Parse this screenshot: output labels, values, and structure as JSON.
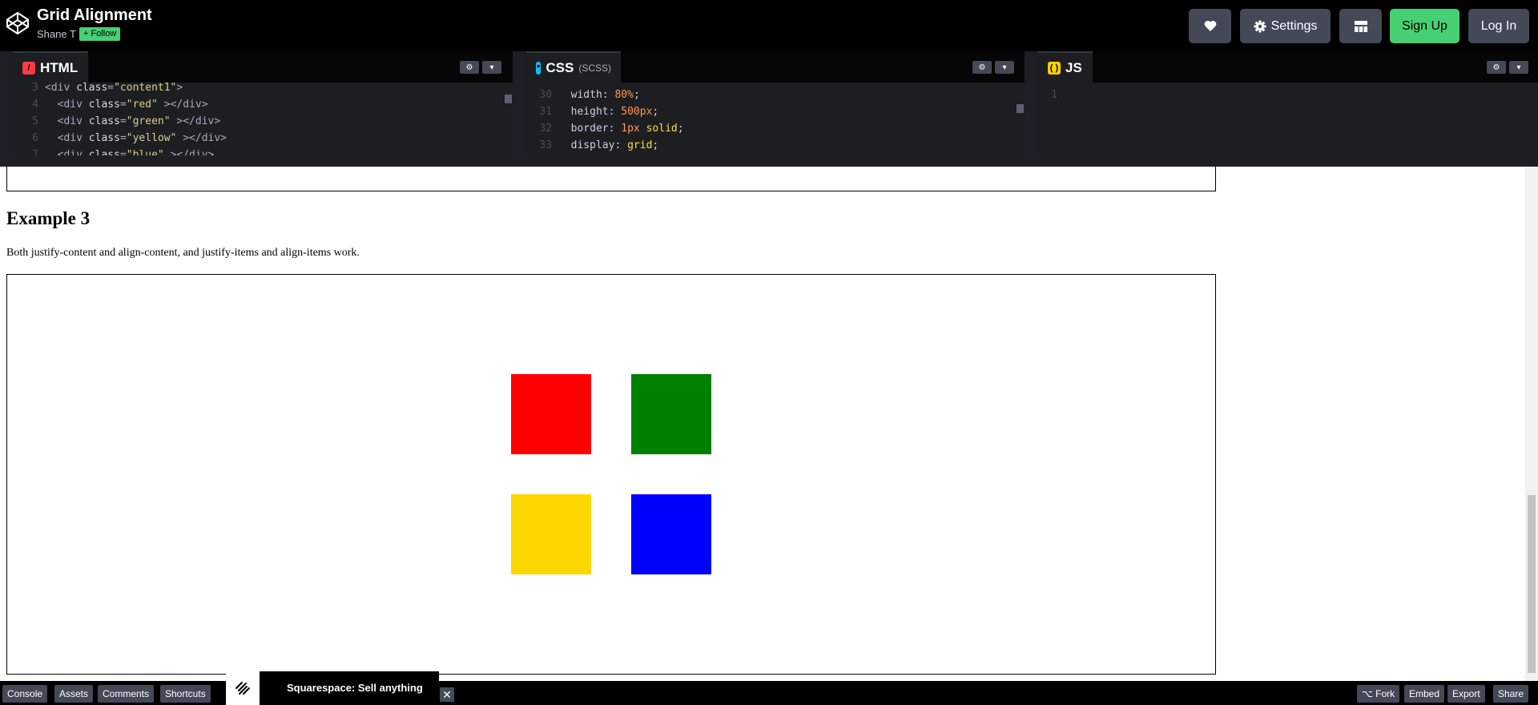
{
  "header": {
    "title": "Grid Alignment",
    "author": "Shane T",
    "follow_label": "+ Follow",
    "settings_label": "Settings",
    "signup_label": "Sign Up",
    "login_label": "Log In"
  },
  "editors": {
    "html": {
      "tab_label": "HTML",
      "lines": [
        {
          "n": "3",
          "parts": [
            [
              "tag",
              "<div "
            ],
            [
              "attr",
              "class"
            ],
            [
              "tag",
              "="
            ],
            [
              "str",
              "\"content1\""
            ],
            [
              "tag",
              ">"
            ]
          ]
        },
        {
          "n": "4",
          "parts": [
            [
              "plain",
              "  "
            ],
            [
              "tag",
              "<div "
            ],
            [
              "attr",
              "class"
            ],
            [
              "tag",
              "="
            ],
            [
              "str",
              "\"red\""
            ],
            [
              "tag",
              " ></div>"
            ]
          ]
        },
        {
          "n": "5",
          "parts": [
            [
              "plain",
              "  "
            ],
            [
              "tag",
              "<div "
            ],
            [
              "attr",
              "class"
            ],
            [
              "tag",
              "="
            ],
            [
              "str",
              "\"green\""
            ],
            [
              "tag",
              " ></div>"
            ]
          ]
        },
        {
          "n": "6",
          "parts": [
            [
              "plain",
              "  "
            ],
            [
              "tag",
              "<div "
            ],
            [
              "attr",
              "class"
            ],
            [
              "tag",
              "="
            ],
            [
              "str",
              "\"yellow\""
            ],
            [
              "tag",
              " ></div>"
            ]
          ]
        },
        {
          "n": "7",
          "parts": [
            [
              "plain",
              "  "
            ],
            [
              "tag",
              "<div "
            ],
            [
              "attr",
              "class"
            ],
            [
              "tag",
              "="
            ],
            [
              "str",
              "\"blue\""
            ],
            [
              "tag",
              " ></div>"
            ]
          ]
        }
      ]
    },
    "css": {
      "tab_label": "CSS",
      "tab_sub": "(SCSS)",
      "lines": [
        {
          "n": "30",
          "parts": [
            [
              "prop",
              "  width"
            ],
            [
              "plain",
              ": "
            ],
            [
              "num",
              "80%"
            ],
            [
              "plain",
              ";"
            ]
          ]
        },
        {
          "n": "31",
          "parts": [
            [
              "prop",
              "  height"
            ],
            [
              "plain",
              ": "
            ],
            [
              "num",
              "500px"
            ],
            [
              "plain",
              ";"
            ]
          ]
        },
        {
          "n": "32",
          "parts": [
            [
              "prop",
              "  border"
            ],
            [
              "plain",
              ": "
            ],
            [
              "num",
              "1px"
            ],
            [
              "plain",
              " "
            ],
            [
              "kw",
              "solid"
            ],
            [
              "plain",
              ";"
            ]
          ]
        },
        {
          "n": "33",
          "parts": [
            [
              "prop",
              "  display"
            ],
            [
              "plain",
              ": "
            ],
            [
              "kw",
              "grid"
            ],
            [
              "plain",
              ";"
            ]
          ]
        }
      ]
    },
    "js": {
      "tab_label": "JS",
      "lines": [
        {
          "n": "1",
          "parts": []
        }
      ]
    }
  },
  "preview": {
    "example_title": "Example 3",
    "example_desc": "Both justify-content and align-content, and justify-items and align-items work.",
    "squares": [
      {
        "name": "red-square",
        "color": "#ff0000"
      },
      {
        "name": "green-square",
        "color": "#008000"
      },
      {
        "name": "yellow-square",
        "color": "#ffd700"
      },
      {
        "name": "blue-square",
        "color": "#0000ff"
      }
    ]
  },
  "footer": {
    "console": "Console",
    "assets": "Assets",
    "comments": "Comments",
    "shortcuts": "Shortcuts",
    "ad_text": "Squarespace: Sell anything",
    "ad_close": "✕",
    "fork": "⌥ Fork",
    "embed": "Embed",
    "export": "Export",
    "share": "Share"
  },
  "colors": {
    "accent_green": "#47cf73",
    "button_gray": "#444857",
    "html_icon": "#ff3c41",
    "css_icon": "#0ebeff",
    "js_icon": "#fcd000"
  }
}
